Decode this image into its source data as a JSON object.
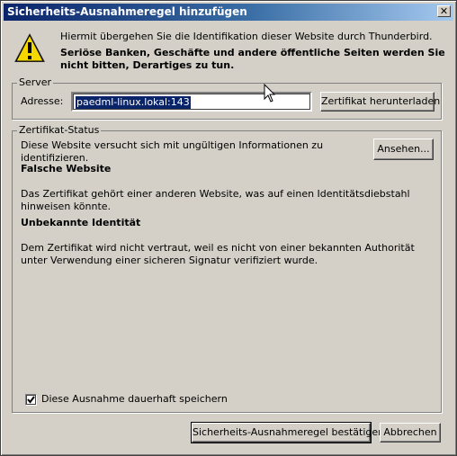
{
  "window": {
    "title": "Sicherheits-Ausnahmeregel hinzufügen",
    "close_symbol": "✕"
  },
  "warning": {
    "icon": "warning-icon",
    "intro": "Hiermit übergehen Sie die Identifikation dieser Website durch Thunderbird.",
    "bold": "Seriöse Banken, Geschäfte und andere öffentliche Seiten werden Sie nicht bitten, Derartiges zu tun."
  },
  "server": {
    "legend": "Server",
    "address_label": "Adresse:",
    "address_value": "paedml-linux.lokal:143",
    "download_button": "Zertifikat herunterladen"
  },
  "status": {
    "legend": "Zertifikat-Status",
    "summary": "Diese Website versucht sich mit ungültigen Informationen zu identifizieren.",
    "view_button": "Ansehen...",
    "issues": [
      {
        "heading": "Falsche Website",
        "text": "Das Zertifikat gehört einer anderen Website, was auf einen Identitätsdiebstahl hinweisen könnte."
      },
      {
        "heading": "Unbekannte Identität",
        "text": "Dem Zertifikat wird nicht vertraut, weil es nicht von einer bekannten Authorität unter Verwendung einer sicheren Signatur verifiziert wurde."
      }
    ]
  },
  "permanent": {
    "checked": true,
    "label": "Diese Ausnahme dauerhaft speichern"
  },
  "buttons": {
    "confirm": "Sicherheits-Ausnahmeregel bestätigen",
    "cancel": "Abbrechen"
  },
  "colors": {
    "dialog_bg": "#d4d0c8",
    "titlebar_start": "#0a246a",
    "titlebar_end": "#a6caf0",
    "warning_yellow": "#f5d800",
    "selection_bg": "#0a246a"
  }
}
